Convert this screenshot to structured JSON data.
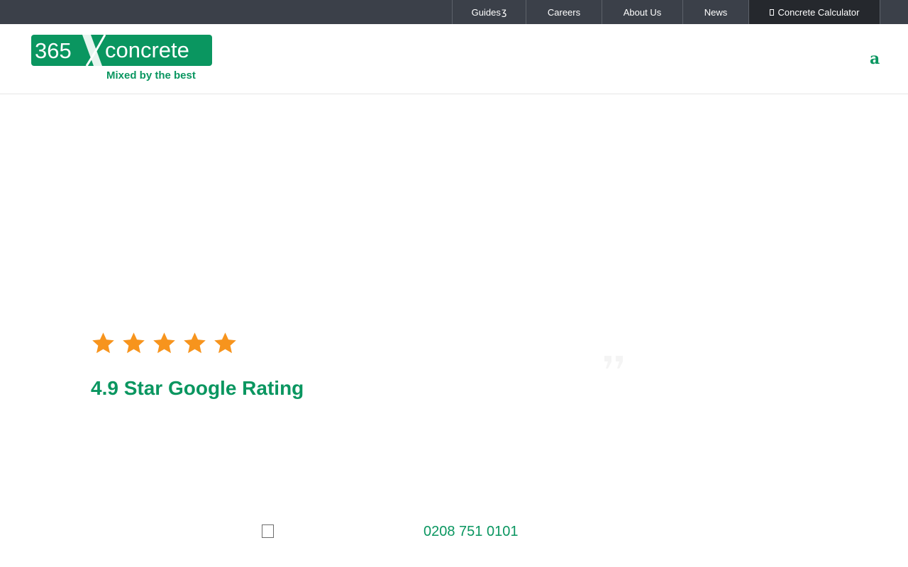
{
  "topnav": {
    "guides": "Guides",
    "careers": "Careers",
    "about": "About Us",
    "news": "News",
    "calculator": "Concrete Calculator"
  },
  "logo": {
    "brand_number": "365",
    "brand_word": "concrete",
    "tagline": "Mixed by the best"
  },
  "header": {
    "menu_glyph": "a"
  },
  "hero": {
    "stars": 5,
    "rating_text": "4.9 Star Google Rating"
  },
  "contact": {
    "phone": "0208 751 0101"
  },
  "colors": {
    "brand_green": "#0a9660",
    "star_orange": "#f7941d",
    "topbar": "#3b4049",
    "topbar_active": "#25282d"
  },
  "icons": {
    "guides_dropdown": "chevron-down-icon",
    "calculator": "calculator-icon",
    "header_menu": "menu-icon",
    "star": "star-icon",
    "phone": "phone-icon"
  }
}
